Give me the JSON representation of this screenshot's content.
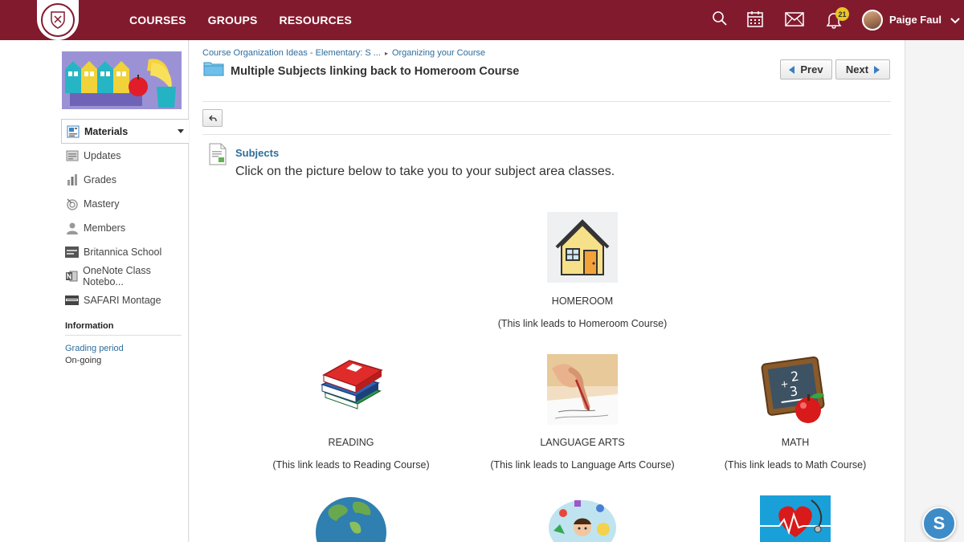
{
  "nav": {
    "courses": "COURSES",
    "groups": "GROUPS",
    "resources": "RESOURCES"
  },
  "header": {
    "notification_count": "21",
    "user_name": "Paige Faul"
  },
  "sidebar": {
    "items": [
      {
        "label": "Materials",
        "icon": "materials-icon",
        "active": true
      },
      {
        "label": "Updates",
        "icon": "updates-icon"
      },
      {
        "label": "Grades",
        "icon": "grades-icon"
      },
      {
        "label": "Mastery",
        "icon": "mastery-icon"
      },
      {
        "label": "Members",
        "icon": "members-icon"
      },
      {
        "label": "Britannica School",
        "icon": "britannica-icon"
      },
      {
        "label": "OneNote Class Notebo...",
        "icon": "onenote-icon"
      },
      {
        "label": "SAFARI Montage",
        "icon": "safari-icon"
      }
    ],
    "info_heading": "Information",
    "grading_period_label": "Grading period",
    "grading_period_value": "On-going"
  },
  "breadcrumb": {
    "item1": "Course Organization Ideas - Elementary: S ...",
    "separator": "▸",
    "item2": "Organizing your Course"
  },
  "page": {
    "title": "Multiple Subjects linking back to Homeroom Course",
    "prev": "Prev",
    "next": "Next"
  },
  "content": {
    "heading": "Subjects",
    "description": "Click on the picture below to take you to your subject area classes.",
    "tiles": [
      {
        "label": "HOMEROOM",
        "sub": "(This link leads to Homeroom Course)"
      },
      {
        "label": "READING",
        "sub": "(This link leads to Reading Course)"
      },
      {
        "label": "LANGUAGE ARTS",
        "sub": "(This link leads to Language Arts Course)"
      },
      {
        "label": "MATH",
        "sub": "(This link leads to Math Course)"
      }
    ]
  },
  "fab": {
    "label": "S"
  },
  "colors": {
    "brand": "#821a2e",
    "link": "#2d6d9b",
    "badge": "#e8c625"
  }
}
